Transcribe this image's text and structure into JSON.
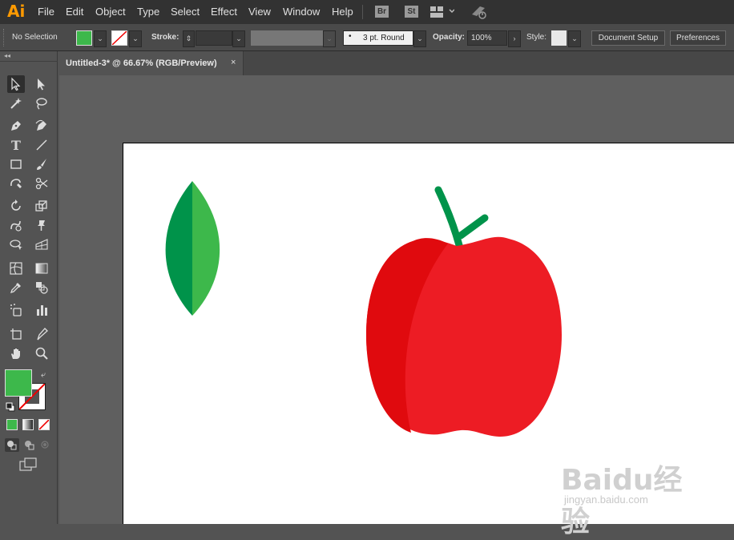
{
  "app": {
    "logo": "Ai"
  },
  "menu": [
    "File",
    "Edit",
    "Object",
    "Type",
    "Select",
    "Effect",
    "View",
    "Window",
    "Help"
  ],
  "app_buttons": {
    "bridge": "Br",
    "stock": "St"
  },
  "control_bar": {
    "selection": "No Selection",
    "stroke_label": "Stroke:",
    "brush_label": "3 pt. Round",
    "opacity_label": "Opacity:",
    "opacity_value": "100%",
    "style_label": "Style:",
    "document_setup": "Document Setup",
    "preferences": "Preferences"
  },
  "document_tab": {
    "title": "Untitled-3* @ 66.67% (RGB/Preview)",
    "close": "×"
  },
  "colors": {
    "fill": "#3db84b",
    "leaf_dark": "#00934a",
    "leaf_light": "#3db84b",
    "apple_dark": "#e00a0e",
    "apple_light": "#ed1c24",
    "stem": "#00934a"
  },
  "watermark": {
    "main": "Baidu经验",
    "sub": "jingyan.baidu.com"
  }
}
